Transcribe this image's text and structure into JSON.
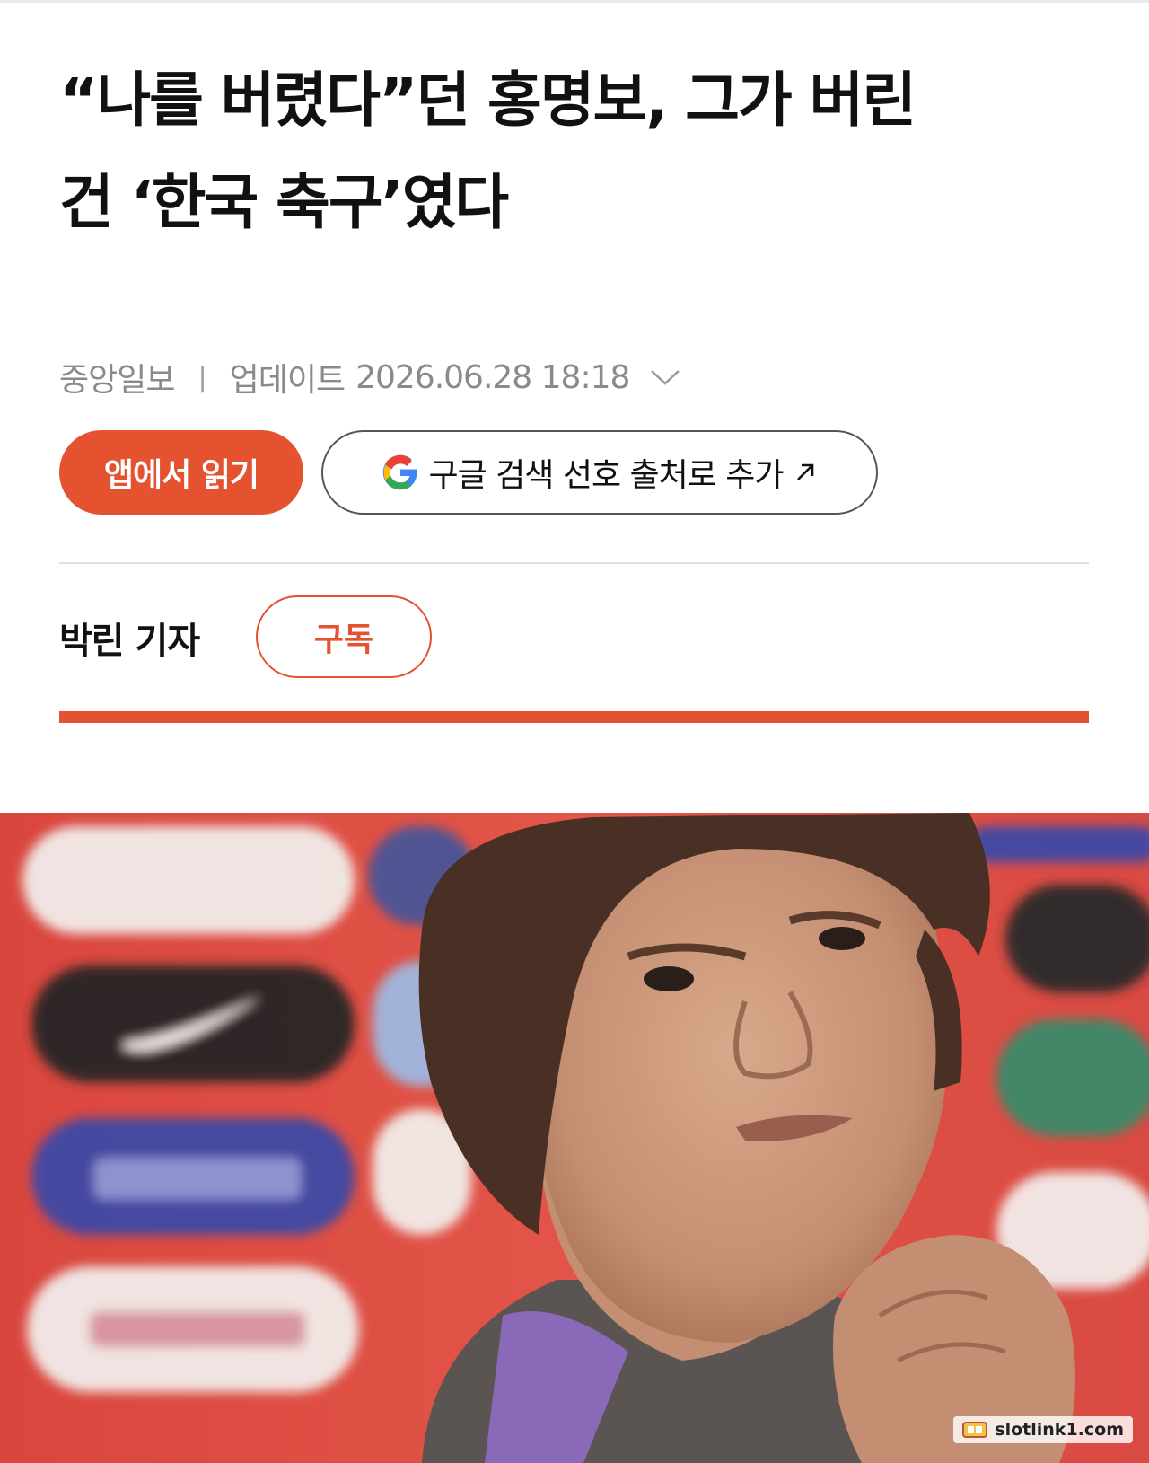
{
  "article": {
    "title_line1": "“나를 버렸다”던 홍명보, 그가 버린",
    "title_line2": "건 ‘한국 축구’였다",
    "publisher": "중앙일보",
    "separator": "|",
    "updated_label": "업데이트",
    "updated_at": "2026.06.28 18:18"
  },
  "buttons": {
    "read_in_app": "앱에서 읽기",
    "google_preferred_source": "구글 검색 선호 출처로 추가"
  },
  "reporter": {
    "name": "박린 기자",
    "subscribe_label": "구독"
  },
  "photo": {
    "watermark": "slotlink1.com"
  },
  "colors": {
    "accent": "#e4522f",
    "meta_text": "#8a8a8a",
    "divider": "#e0e0e0"
  },
  "icons": {
    "updated_toggle": "chevron-down-icon",
    "google_logo": "google-g-icon",
    "external_link": "arrow-up-right-icon"
  }
}
